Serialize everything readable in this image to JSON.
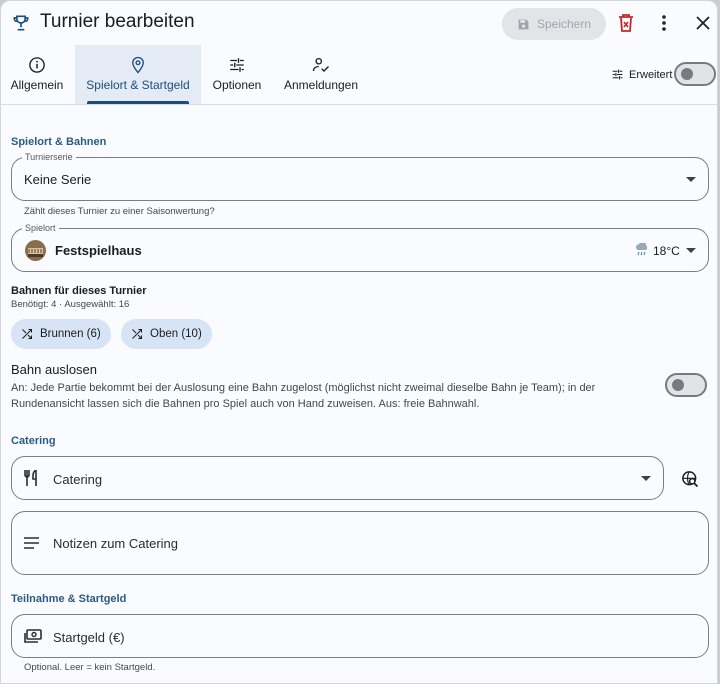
{
  "header": {
    "title": "Turnier bearbeiten",
    "save_label": "Speichern"
  },
  "tabs": [
    {
      "label": "Allgemein",
      "icon": "info-icon",
      "active": false
    },
    {
      "label": "Spielort & Startgeld",
      "icon": "location-pin-icon",
      "active": true
    },
    {
      "label": "Optionen",
      "icon": "sliders-icon",
      "active": false
    },
    {
      "label": "Anmeldungen",
      "icon": "person-check-icon",
      "active": false
    }
  ],
  "advanced": {
    "label": "Erweitert",
    "enabled": false
  },
  "venue": {
    "section_title": "Spielort & Bahnen",
    "series_label": "Turnierserie",
    "series_value": "Keine Serie",
    "series_hint": "Zählt dieses Turnier zu einer Saisonwertung?",
    "venue_label": "Spielort",
    "venue_value": "Festspielhaus",
    "weather_temp": "18°C",
    "weather_icon": "rain-cloud-icon"
  },
  "lanes": {
    "title": "Bahnen für dieses Turnier",
    "summary": "Benötigt: 4 · Ausgewählt: 16",
    "chips": [
      {
        "label": "Brunnen (6)",
        "icon": "shuffle-icon"
      },
      {
        "label": "Oben (10)",
        "icon": "shuffle-icon"
      }
    ],
    "draw_title": "Bahn auslosen",
    "draw_desc": "An: Jede Partie bekommt bei der Auslosung eine Bahn zugelost (möglichst nicht zweimal dieselbe Bahn je Team); in der Rundenansicht lassen sich die Bahnen pro Spiel auch von Hand zuweisen. Aus: freie Bahnwahl.",
    "draw_enabled": false
  },
  "catering": {
    "section_title": "Catering",
    "select_placeholder": "Catering",
    "notes_placeholder": "Notizen zum Catering"
  },
  "fee": {
    "section_title": "Teilnahme & Startgeld",
    "placeholder": "Startgeld (€)",
    "hint": "Optional. Leer = kein Startgeld."
  },
  "colors": {
    "accent": "#1a4f7c",
    "section": "#2a5b86",
    "chip_bg": "#d6e4f5",
    "delete": "#c62828"
  }
}
